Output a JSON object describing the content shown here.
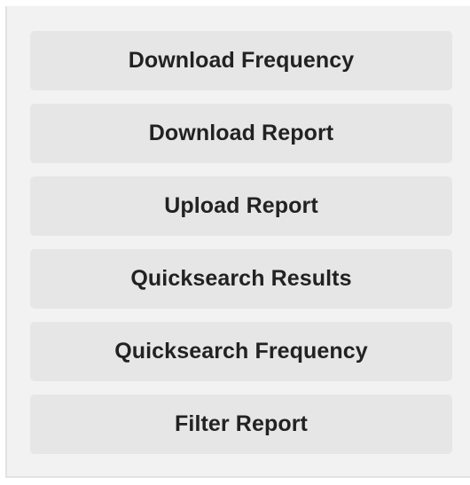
{
  "panel": {
    "background": "#f2f2f2",
    "button_background": "#e6e6e6",
    "text_color": "#222222",
    "buttons": [
      {
        "label": "Download Frequency"
      },
      {
        "label": "Download Report"
      },
      {
        "label": "Upload Report"
      },
      {
        "label": "Quicksearch Results"
      },
      {
        "label": "Quicksearch Frequency"
      },
      {
        "label": "Filter Report"
      }
    ]
  }
}
